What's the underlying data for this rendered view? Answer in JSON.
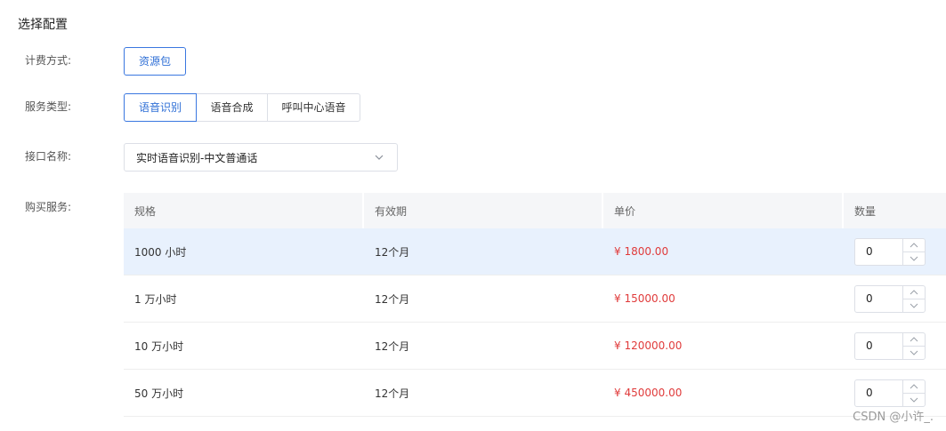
{
  "section_title": "选择配置",
  "billing": {
    "label": "计费方式:",
    "option": "资源包"
  },
  "service_type": {
    "label": "服务类型:",
    "options": [
      "语音识别",
      "语音合成",
      "呼叫中心语音"
    ],
    "selected": "语音识别"
  },
  "api_name": {
    "label": "接口名称:",
    "value": "实时语音识别-中文普通话"
  },
  "purchase": {
    "label": "购买服务:",
    "headers": [
      "规格",
      "有效期",
      "单价",
      "数量"
    ],
    "rows": [
      {
        "spec": "1000 小时",
        "validity": "12个月",
        "price": "¥ 1800.00",
        "qty": "0",
        "selected": true
      },
      {
        "spec": "1 万小时",
        "validity": "12个月",
        "price": "¥ 15000.00",
        "qty": "0",
        "selected": false
      },
      {
        "spec": "10 万小时",
        "validity": "12个月",
        "price": "¥ 120000.00",
        "qty": "0",
        "selected": false
      },
      {
        "spec": "50 万小时",
        "validity": "12个月",
        "price": "¥ 450000.00",
        "qty": "0",
        "selected": false
      }
    ]
  },
  "watermark": "CSDN @小许_.",
  "colors": {
    "accent": "#2f6fd6",
    "price": "#e03b3b",
    "selected_row": "#e8f1fd",
    "header_bg": "#f5f6f8"
  },
  "icons": {
    "select_arrow": "chevron-down-icon",
    "stepper_up": "chevron-up-icon",
    "stepper_down": "chevron-down-icon"
  }
}
